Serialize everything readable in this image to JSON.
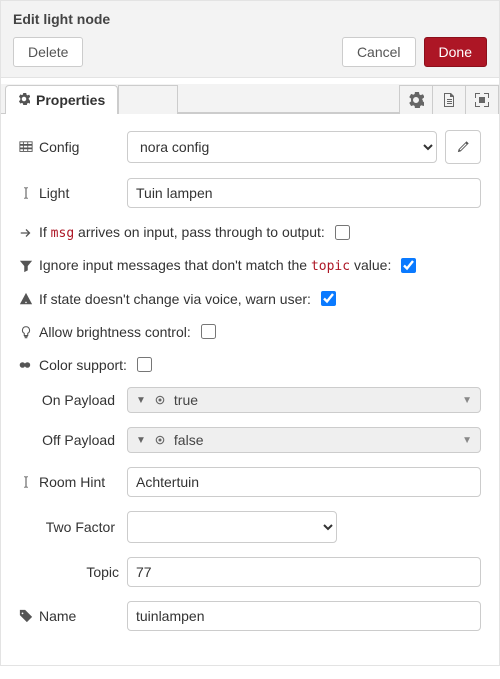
{
  "header": {
    "title": "Edit light node",
    "delete_label": "Delete",
    "cancel_label": "Cancel",
    "done_label": "Done"
  },
  "tab": {
    "properties_label": "Properties"
  },
  "form": {
    "config_label": "Config",
    "config_value": "nora config",
    "light_label": "Light",
    "light_value": "Tuin lampen",
    "passthrough_prefix": "If ",
    "passthrough_msg": "msg",
    "passthrough_suffix": " arrives on input, pass through to output:",
    "ignore_prefix": "Ignore input messages that don't match the ",
    "ignore_topic": "topic",
    "ignore_suffix": " value:",
    "warn_text": "If state doesn't change via voice, warn user:",
    "brightness_text": "Allow brightness control:",
    "color_text": "Color support:",
    "on_payload_label": "On Payload",
    "on_payload_value": "true",
    "off_payload_label": "Off Payload",
    "off_payload_value": "false",
    "room_hint_label": "Room Hint",
    "room_hint_value": "Achtertuin",
    "two_factor_label": "Two Factor",
    "two_factor_value": "",
    "topic_label": "Topic",
    "topic_value": "77",
    "name_label": "Name",
    "name_value": "tuinlampen"
  },
  "checks": {
    "passthrough": false,
    "ignore_topic": true,
    "warn_user": true,
    "brightness": false,
    "color": false
  }
}
